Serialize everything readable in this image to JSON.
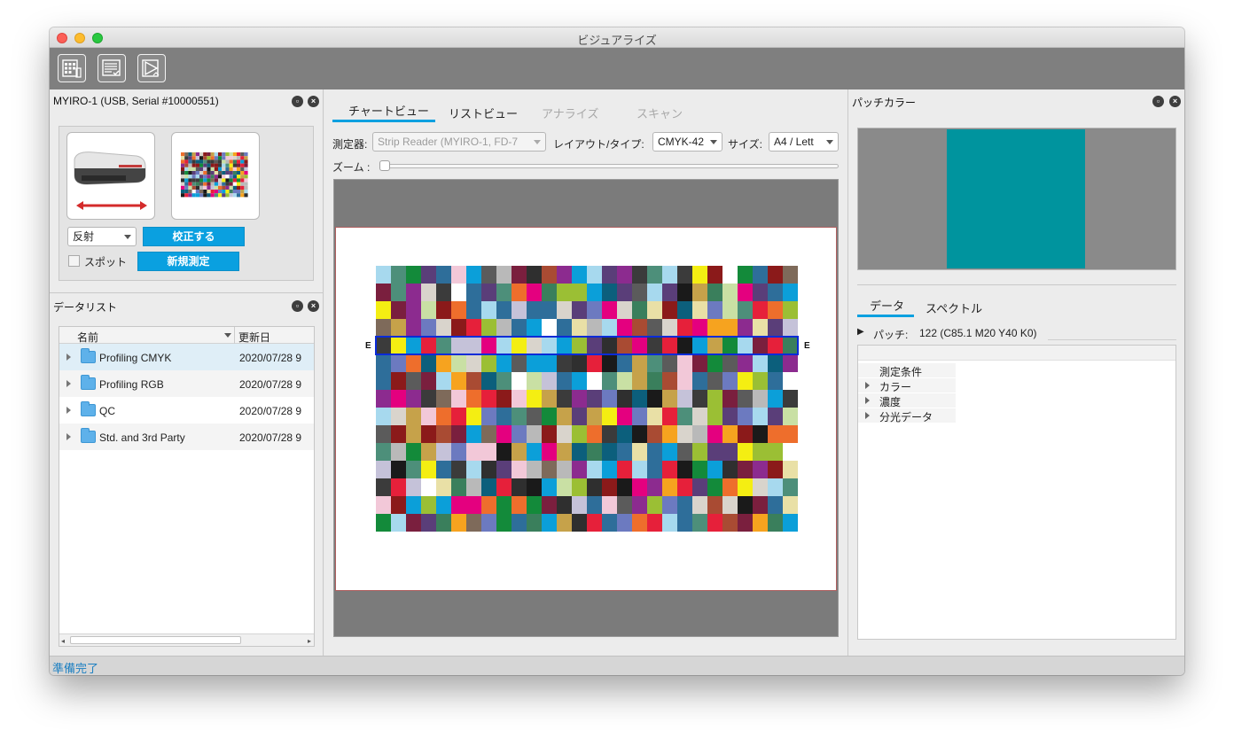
{
  "window": {
    "title": "ビジュアライズ"
  },
  "toolbar": {
    "icons": [
      "chart-icon",
      "list-icon",
      "analyze-icon"
    ]
  },
  "left_panel": {
    "device_title": "MYIRO-1 (USB, Serial #10000551)",
    "mode_select": "反射",
    "calibrate_button": "校正する",
    "spot_label": "スポット",
    "new_measure_button": "新規測定",
    "datalist_title": "データリスト",
    "columns": {
      "name": "名前",
      "updated": "更新日"
    },
    "rows": [
      {
        "name": "Profiling CMYK",
        "date": "2020/07/28 9"
      },
      {
        "name": "Profiling RGB",
        "date": "2020/07/28 9"
      },
      {
        "name": "QC",
        "date": "2020/07/28 9"
      },
      {
        "name": "Std. and 3rd Party",
        "date": "2020/07/28 9"
      }
    ]
  },
  "center_panel": {
    "tabs": [
      "チャートビュー",
      "リストビュー",
      "アナライズ",
      "スキャン"
    ],
    "instrument_label": "測定器:",
    "instrument_value": "Strip Reader (MYIRO-1, FD-7",
    "layout_label": "レイアウト/タイプ:",
    "layout_value": "CMYK-42",
    "size_label": "サイズ:",
    "size_value": "A4 / Lett",
    "zoom_label": "ズーム :",
    "zoom_level": 0,
    "row_marker": "E",
    "selected_row": 5
  },
  "right_panel": {
    "title": "パッチカラー",
    "swatch_color": "#00949e",
    "tabs": [
      "データ",
      "スペクトル"
    ],
    "patch_label": "パッチ:",
    "patch_value": "122 (C85.1 M20 Y40 K0)",
    "props": [
      "測定条件",
      "カラー",
      "濃度",
      "分光データ"
    ]
  },
  "status": {
    "text": "準備完了"
  },
  "colors": {
    "accent": "#0aa0e0",
    "palette": [
      "#e6203a",
      "#f4ee12",
      "#0b9fd9",
      "#138a3a",
      "#e4007f",
      "#3b3b3b",
      "#7e6a5a",
      "#5a3e79",
      "#d9d4cc",
      "#2f2f2f",
      "#ee6e2c",
      "#9bbf34",
      "#c6a24a",
      "#7a1f3e",
      "#2e6e9a",
      "#a7d9ee",
      "#f2c8d8",
      "#4d8f7a",
      "#b9b9b9",
      "#1a1a1a",
      "#c9e0a4",
      "#8c2b8f",
      "#f6a31f",
      "#6c7ac0",
      "#3a7f5c",
      "#a94b33",
      "#c5c2d9",
      "#e9e0a6",
      "#5b5b5b",
      "#0c5f7c",
      "#8b1a1a",
      "#ffffff"
    ]
  }
}
